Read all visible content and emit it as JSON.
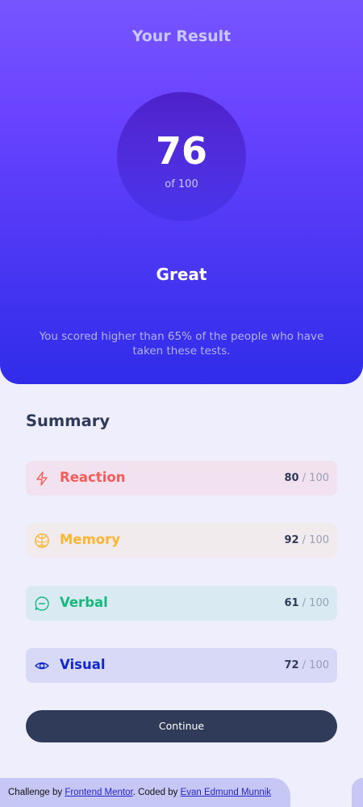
{
  "result": {
    "title": "Your Result",
    "score": "76",
    "of_label": "of 100",
    "rating": "Great",
    "blurb": "You scored higher than 65% of the people who have taken these tests."
  },
  "summary": {
    "title": "Summary",
    "items": [
      {
        "label": "Reaction",
        "score": "80",
        "total": " / 100",
        "icon": "lightning-icon",
        "color": "#f45c5a",
        "bg": "#f2e2ef"
      },
      {
        "label": "Memory",
        "score": "92",
        "total": " / 100",
        "icon": "brain-icon",
        "color": "#f8b631",
        "bg": "#f2ebee"
      },
      {
        "label": "Verbal",
        "score": "61",
        "total": " / 100",
        "icon": "chat-bubble-icon",
        "color": "#16b97c",
        "bg": "#d9eaf3"
      },
      {
        "label": "Visual",
        "score": "72",
        "total": " / 100",
        "icon": "eye-icon",
        "color": "#1127c9",
        "bg": "#d8d9f7"
      }
    ]
  },
  "actions": {
    "continue_label": "Continue"
  },
  "footer": {
    "challenge_prefix": "Challenge by ",
    "challenge_link": "Frontend Mentor",
    "coded_prefix": ". Coded by ",
    "coded_link": "Evan Edmund Munnik"
  }
}
